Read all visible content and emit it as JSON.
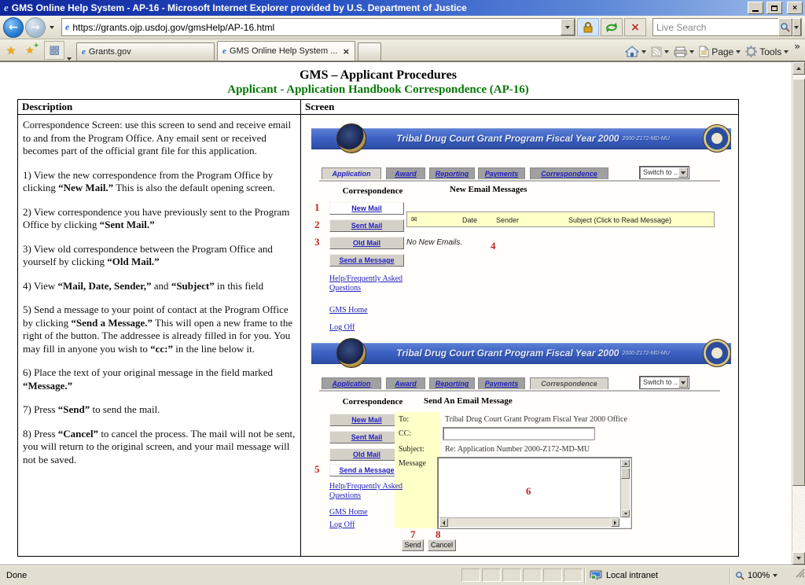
{
  "window": {
    "title": "GMS Online Help System - AP-16 - Microsoft Internet Explorer provided by U.S. Department of Justice"
  },
  "toolbar": {
    "address": "https://grants.ojp.usdoj.gov/gmsHelp/AP-16.html",
    "search_placeholder": "Live Search"
  },
  "tab_bar": {
    "tabs": [
      {
        "label": "Grants.gov"
      },
      {
        "label": "GMS Online Help System ..."
      }
    ]
  },
  "command_bar": {
    "page": "Page",
    "tools": "Tools",
    "overflow": "»"
  },
  "help_page": {
    "title": "GMS – Applicant Procedures",
    "subtitle": "Applicant - Application Handbook Correspondence (AP-16)",
    "columns": {
      "description": "Description",
      "screen": "Screen"
    },
    "description_paragraphs": [
      [
        {
          "t": "Correspondence Screen: use this screen to send and receive email to and from the Program Office. Any email sent or received becomes part of the official grant file for this application."
        }
      ],
      [
        {
          "t": "1) View the new correspondence from the Program Office by clicking "
        },
        {
          "t": "“New Mail.”",
          "b": true
        },
        {
          "t": " This is also the default opening screen."
        }
      ],
      [
        {
          "t": "2) View correspondence you have previously sent to the Program Office by clicking "
        },
        {
          "t": "“Sent Mail.”",
          "b": true
        }
      ],
      [
        {
          "t": "3) View old correspondence between the Program Office and yourself by clicking "
        },
        {
          "t": "“Old Mail.”",
          "b": true
        }
      ],
      [
        {
          "t": "4) View "
        },
        {
          "t": "“Mail, Date, Sender,”",
          "b": true
        },
        {
          "t": " and "
        },
        {
          "t": "“Subject”",
          "b": true
        },
        {
          "t": " in this field"
        }
      ],
      [
        {
          "t": "5) Send a message to your point of contact at the Program Office by clicking "
        },
        {
          "t": "“Send a Message.”",
          "b": true
        },
        {
          "t": "  This will open a new frame to the right of the button. The addressee is already filled in for you.  You may fill in anyone you wish to "
        },
        {
          "t": "“cc:”",
          "b": true
        },
        {
          "t": " in the line below it."
        }
      ],
      [
        {
          "t": "6) Place the text of your original message in the field marked "
        },
        {
          "t": "“Message.”",
          "b": true
        }
      ],
      [
        {
          "t": "7) Press "
        },
        {
          "t": "“Send”",
          "b": true
        },
        {
          "t": " to send the mail."
        }
      ],
      [
        {
          "t": "8) Press "
        },
        {
          "t": "“Cancel”",
          "b": true
        },
        {
          "t": " to cancel the process.  The mail will not be sent, you will return to the original screen, and your mail message will not be saved."
        }
      ]
    ]
  },
  "gms": {
    "banner": {
      "program": "Tribal Drug Court Grant Program Fiscal Year 2000",
      "number": "2000-Z172-MD-MU"
    },
    "nav": [
      "Application",
      "Award",
      "Reporting",
      "Payments",
      "Correspondence"
    ],
    "switch": "Switch to ...",
    "sidebar": {
      "label": "Correspondence",
      "buttons": [
        "New Mail",
        "Sent Mail",
        "Old Mail",
        "Send a Message"
      ],
      "links": [
        "Help/Frequently Asked Questions",
        "GMS Home",
        "Log Off"
      ]
    },
    "shot1": {
      "heading": "New Email Messages",
      "list_headers": [
        "Date",
        "Sender",
        "Subject (Click to Read Message)"
      ],
      "empty": "No New Emails."
    },
    "shot2": {
      "heading": "Send An Email Message",
      "to_label": "To:",
      "to_value": "Tribal Drug Court Grant Program Fiscal Year 2000 Office",
      "cc_label": "CC:",
      "subject_label": "Subject:",
      "subject_value": "Re: Application Number 2000-Z172-MD-MU",
      "message_label": "Message",
      "send": "Send",
      "cancel": "Cancel"
    }
  },
  "callouts": [
    "1",
    "2",
    "3",
    "4",
    "5",
    "6",
    "7",
    "8"
  ],
  "status_bar": {
    "status": "Done",
    "zone": "Local intranet",
    "zoom": "100%"
  }
}
